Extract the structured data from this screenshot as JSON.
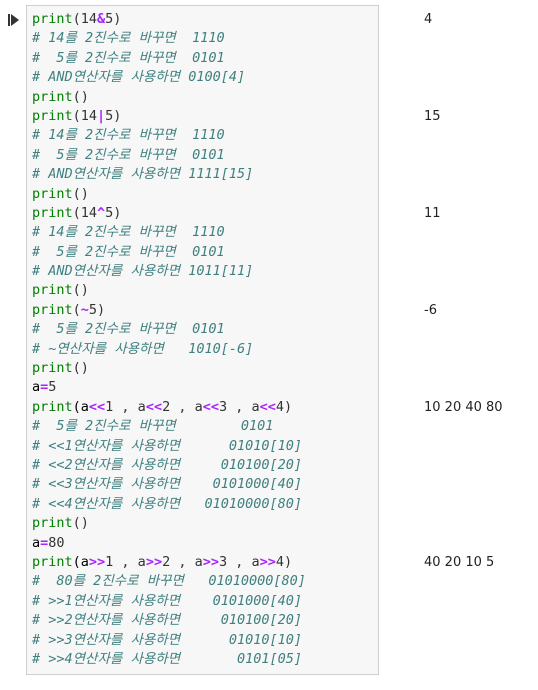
{
  "cell": {
    "run_icon": "run-cell-icon",
    "colors": {
      "function": "#008000",
      "operator": "#aa22ff",
      "comment": "#408080",
      "background": "#f7f7f7",
      "border": "#cfcfcf"
    },
    "lines": [
      [
        {
          "t": "print",
          "k": "func"
        },
        {
          "t": "(14",
          "k": "num"
        },
        {
          "t": "&",
          "k": "op"
        },
        {
          "t": "5)",
          "k": "num"
        }
      ],
      [
        {
          "t": "# 14를 2진수로 바꾸면  1110",
          "k": "comment"
        }
      ],
      [
        {
          "t": "#  5를 2진수로 바꾸면  0101",
          "k": "comment"
        }
      ],
      [
        {
          "t": "# AND연산자를 사용하면 0100[4]",
          "k": "comment"
        }
      ],
      [
        {
          "t": "print",
          "k": "func"
        },
        {
          "t": "()",
          "k": "paren"
        }
      ],
      [
        {
          "t": "print",
          "k": "func"
        },
        {
          "t": "(14",
          "k": "num"
        },
        {
          "t": "|",
          "k": "op"
        },
        {
          "t": "5)",
          "k": "num"
        }
      ],
      [
        {
          "t": "# 14를 2진수로 바꾸면  1110",
          "k": "comment"
        }
      ],
      [
        {
          "t": "#  5를 2진수로 바꾸면  0101",
          "k": "comment"
        }
      ],
      [
        {
          "t": "# AND연산자를 사용하면 1111[15]",
          "k": "comment"
        }
      ],
      [
        {
          "t": "print",
          "k": "func"
        },
        {
          "t": "()",
          "k": "paren"
        }
      ],
      [
        {
          "t": "print",
          "k": "func"
        },
        {
          "t": "(14",
          "k": "num"
        },
        {
          "t": "^",
          "k": "op"
        },
        {
          "t": "5)",
          "k": "num"
        }
      ],
      [
        {
          "t": "# 14를 2진수로 바꾸면  1110",
          "k": "comment"
        }
      ],
      [
        {
          "t": "#  5를 2진수로 바꾸면  0101",
          "k": "comment"
        }
      ],
      [
        {
          "t": "# AND연산자를 사용하면 1011[11]",
          "k": "comment"
        }
      ],
      [
        {
          "t": "print",
          "k": "func"
        },
        {
          "t": "()",
          "k": "paren"
        }
      ],
      [
        {
          "t": "print",
          "k": "func"
        },
        {
          "t": "(",
          "k": "paren"
        },
        {
          "t": "~",
          "k": "op"
        },
        {
          "t": "5)",
          "k": "num"
        }
      ],
      [
        {
          "t": "#  5를 2진수로 바꾸면  0101",
          "k": "comment"
        }
      ],
      [
        {
          "t": "# ~연산자를 사용하면   1010[-6]",
          "k": "comment"
        }
      ],
      [
        {
          "t": "print",
          "k": "func"
        },
        {
          "t": "()",
          "k": "paren"
        }
      ],
      [
        {
          "t": "a",
          "k": "var"
        },
        {
          "t": "=",
          "k": "op"
        },
        {
          "t": "5",
          "k": "num"
        }
      ],
      [
        {
          "t": "print",
          "k": "func"
        },
        {
          "t": "(a",
          "k": "var"
        },
        {
          "t": "<<",
          "k": "op"
        },
        {
          "t": "1 , a",
          "k": "num"
        },
        {
          "t": "<<",
          "k": "op"
        },
        {
          "t": "2 , a",
          "k": "num"
        },
        {
          "t": "<<",
          "k": "op"
        },
        {
          "t": "3 , a",
          "k": "num"
        },
        {
          "t": "<<",
          "k": "op"
        },
        {
          "t": "4)",
          "k": "num"
        }
      ],
      [
        {
          "t": "#  5를 2진수로 바꾸면        0101",
          "k": "comment"
        }
      ],
      [
        {
          "t": "# <<1연산자를 사용하면      01010[10]",
          "k": "comment"
        }
      ],
      [
        {
          "t": "# <<2연산자를 사용하면     010100[20]",
          "k": "comment"
        }
      ],
      [
        {
          "t": "# <<3연산자를 사용하면    0101000[40]",
          "k": "comment"
        }
      ],
      [
        {
          "t": "# <<4연산자를 사용하면   01010000[80]",
          "k": "comment"
        }
      ],
      [
        {
          "t": "print",
          "k": "func"
        },
        {
          "t": "()",
          "k": "paren"
        }
      ],
      [
        {
          "t": "a",
          "k": "var"
        },
        {
          "t": "=",
          "k": "op"
        },
        {
          "t": "80",
          "k": "num"
        }
      ],
      [
        {
          "t": "print",
          "k": "func"
        },
        {
          "t": "(a",
          "k": "var"
        },
        {
          "t": ">>",
          "k": "op"
        },
        {
          "t": "1 , a",
          "k": "num"
        },
        {
          "t": ">>",
          "k": "op"
        },
        {
          "t": "2 , a",
          "k": "num"
        },
        {
          "t": ">>",
          "k": "op"
        },
        {
          "t": "3 , a",
          "k": "num"
        },
        {
          "t": ">>",
          "k": "op"
        },
        {
          "t": "4)",
          "k": "num"
        }
      ],
      [
        {
          "t": "#  80를 2진수로 바꾸면   01010000[80]",
          "k": "comment"
        }
      ],
      [
        {
          "t": "# >>1연산자를 사용하면    0101000[40]",
          "k": "comment"
        }
      ],
      [
        {
          "t": "# >>2연산자를 사용하면     010100[20]",
          "k": "comment"
        }
      ],
      [
        {
          "t": "# >>3연산자를 사용하면      01010[10]",
          "k": "comment"
        }
      ],
      [
        {
          "t": "# >>4연산자를 사용하면       0101[05]",
          "k": "comment"
        }
      ]
    ]
  },
  "outputs": [
    {
      "line": 0,
      "text": "4"
    },
    {
      "line": 5,
      "text": "15"
    },
    {
      "line": 10,
      "text": "11"
    },
    {
      "line": 15,
      "text": "-6"
    },
    {
      "line": 20,
      "text": "10 20 40 80"
    },
    {
      "line": 28,
      "text": "40 20 10 5"
    }
  ]
}
